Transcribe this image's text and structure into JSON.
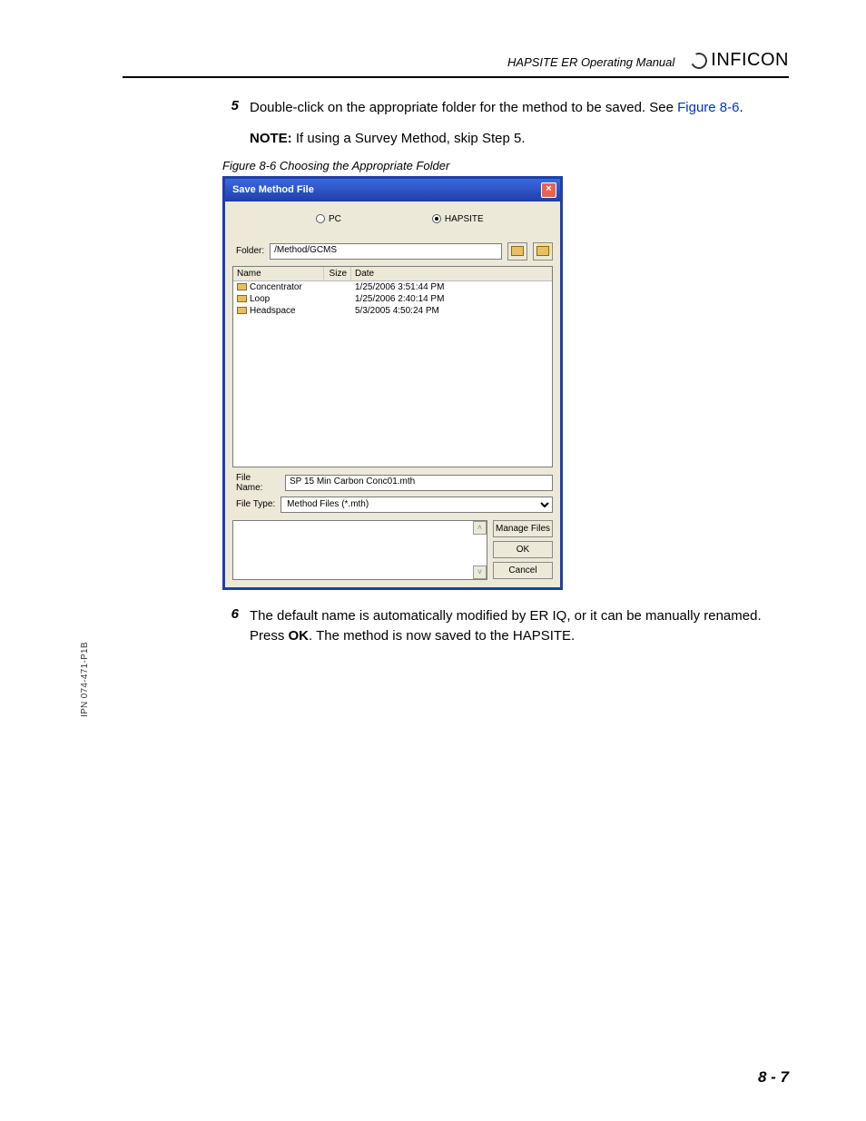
{
  "header": {
    "manual_title": "HAPSITE ER Operating Manual",
    "logo_text": "INFICON"
  },
  "step5": {
    "num": "5",
    "text_a": "Double-click on the appropriate folder for the method to be saved. See ",
    "link1": "Figure 8-6",
    "punct": "."
  },
  "note": {
    "label": "NOTE:",
    "text_a": "  If using a Survey Method, skip ",
    "link": "Step 5",
    "punct": "."
  },
  "figure_caption": "Figure 8-6  Choosing the Appropriate Folder",
  "dialog": {
    "title": "Save Method File",
    "radio_pc": "PC",
    "radio_hapsite": "HAPSITE",
    "folder_label": "Folder:",
    "folder_value": "/Method/GCMS",
    "col_name": "Name",
    "col_size": "Size",
    "col_date": "Date",
    "rows": [
      {
        "name": "Concentrator",
        "date": "1/25/2006 3:51:44 PM"
      },
      {
        "name": "Loop",
        "date": "1/25/2006 2:40:14 PM"
      },
      {
        "name": "Headspace",
        "date": "5/3/2005 4:50:24 PM"
      }
    ],
    "filename_label": "File Name:",
    "filename_value": "SP 15 Min Carbon Conc01.mth",
    "filetype_label": "File Type:",
    "filetype_value": "Method Files (*.mth)",
    "btn_manage": "Manage Files",
    "btn_ok": "OK",
    "btn_cancel": "Cancel"
  },
  "step6": {
    "num": "6",
    "text_a": "The default name is automatically modified by ER IQ, or it can be manually renamed. Press ",
    "ok": "OK",
    "text_b": ". The method is now saved to the HAPSITE."
  },
  "footer": {
    "page_num": "8 - 7"
  },
  "side_ipn": "IPN 074-471-P1B"
}
